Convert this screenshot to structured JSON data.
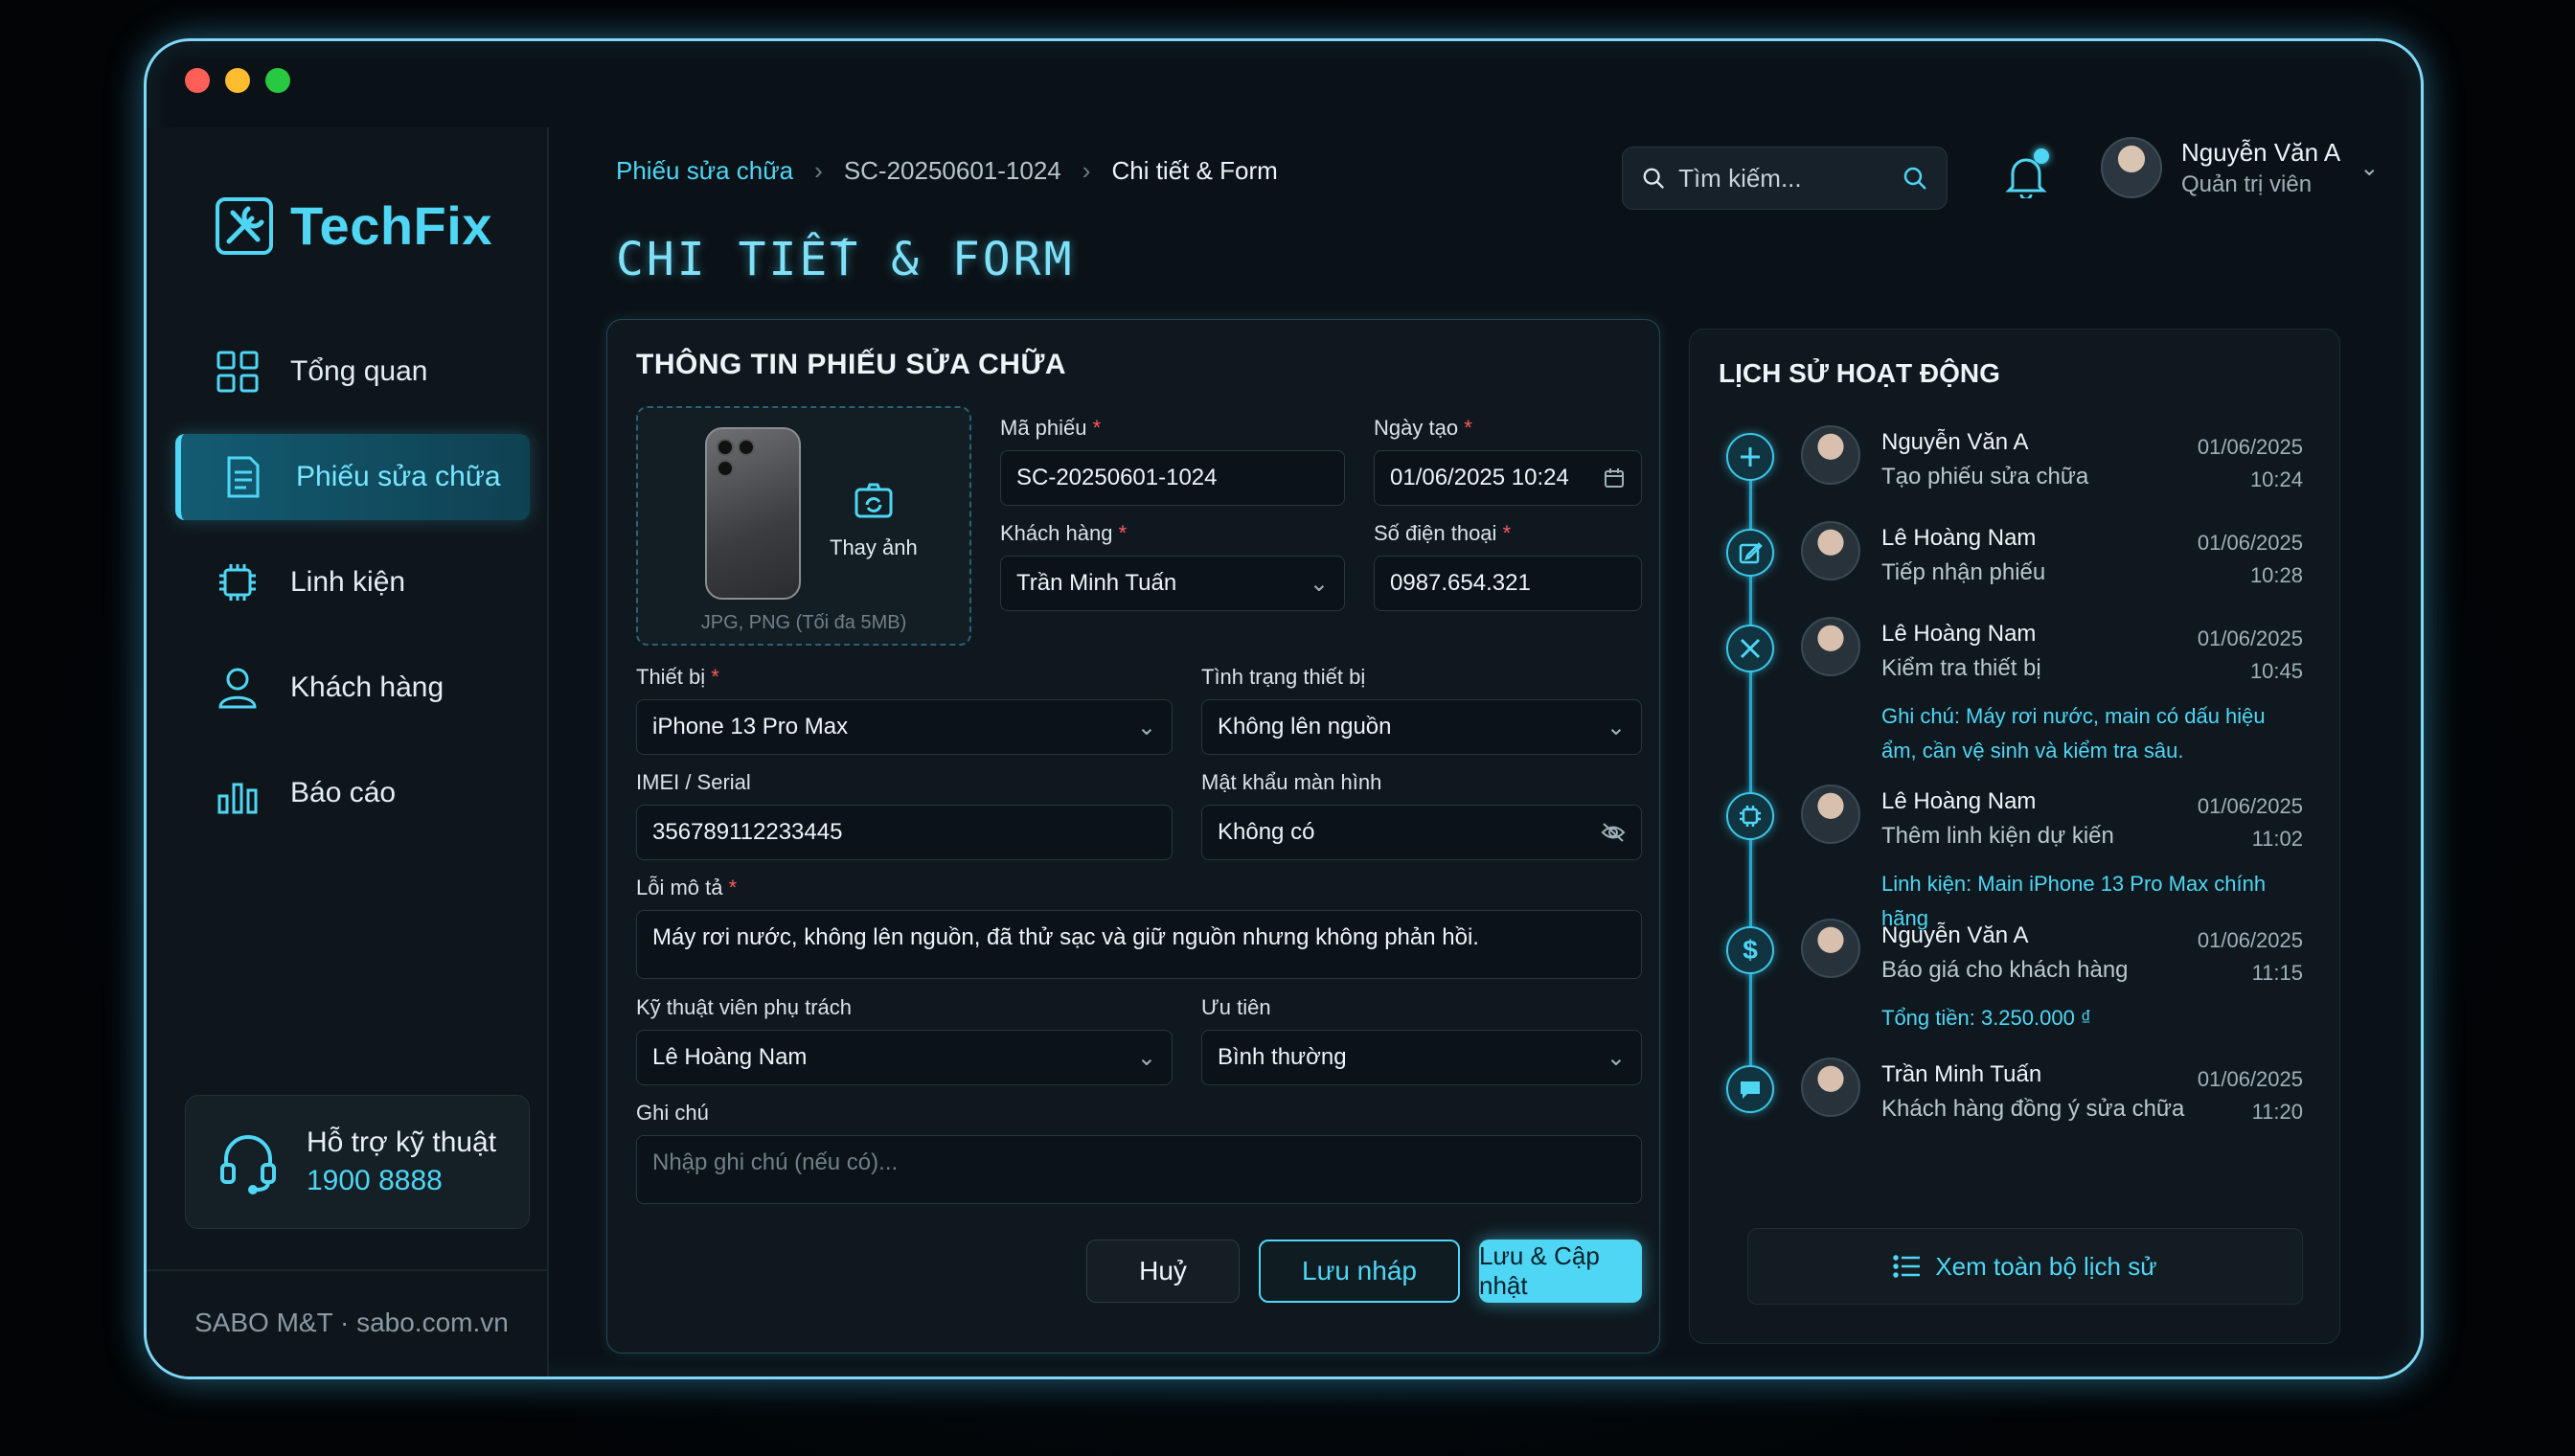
{
  "app": {
    "logo_text": "TechFix",
    "colors": {
      "accent": "#4fd6f5",
      "background": "#0b1217",
      "required": "#ff5a5a"
    }
  },
  "sidebar": {
    "items": [
      {
        "label": "Tổng quan",
        "icon": "dashboard-icon"
      },
      {
        "label": "Phiếu sửa chữa",
        "icon": "document-icon",
        "active": true
      },
      {
        "label": "Linh kiện",
        "icon": "chip-icon"
      },
      {
        "label": "Khách hàng",
        "icon": "user-icon"
      },
      {
        "label": "Báo cáo",
        "icon": "bar-chart-icon"
      }
    ],
    "support": {
      "title": "Hỗ trợ kỹ thuật",
      "phone": "1900 8888"
    },
    "footer": "SABO M&T · sabo.com.vn"
  },
  "header": {
    "breadcrumb": [
      "Phiếu sửa chữa",
      "SC-20250601-1024",
      "Chi tiết & Form"
    ],
    "search_placeholder": "Tìm kiếm...",
    "user": {
      "name": "Nguyễn Văn A",
      "role": "Quản trị viên"
    }
  },
  "page_title": "CHI TIẾT & FORM",
  "form": {
    "title": "THÔNG TIN PHIẾU SỬA CHỮA",
    "photo": {
      "change_label": "Thay ảnh",
      "hint": "JPG, PNG (Tối đa 5MB)"
    },
    "ticket_id": {
      "label": "Mã phiếu",
      "value": "SC-20250601-1024"
    },
    "created_date": {
      "label": "Ngày tạo",
      "value": "01/06/2025 10:24"
    },
    "customer": {
      "label": "Khách hàng",
      "value": "Trần Minh Tuấn"
    },
    "phone": {
      "label": "Số điện thoại",
      "value": "0987.654.321"
    },
    "device": {
      "label": "Thiết bị",
      "value": "iPhone 13 Pro Max"
    },
    "device_status": {
      "label": "Tình trạng thiết bị",
      "value": "Không lên nguồn"
    },
    "imei": {
      "label": "IMEI / Serial",
      "value": "356789112233445"
    },
    "screen_password": {
      "label": "Mật khẩu màn hình",
      "value": "Không có"
    },
    "issue": {
      "label": "Lỗi mô tả",
      "value": "Máy rơi nước, không lên nguồn, đã thử sạc và giữ nguồn nhưng không phản hồi."
    },
    "technician": {
      "label": "Kỹ thuật viên phụ trách",
      "value": "Lê Hoàng Nam"
    },
    "priority": {
      "label": "Ưu tiên",
      "value": "Bình thường"
    },
    "note": {
      "label": "Ghi chú",
      "placeholder": "Nhập ghi chú (nếu có)..."
    },
    "buttons": {
      "cancel": "Huỷ",
      "draft": "Lưu nháp",
      "save": "Lưu & Cập nhật"
    }
  },
  "activity": {
    "title": "LỊCH SỬ HOẠT ĐỘNG",
    "items": [
      {
        "icon": "plus-icon",
        "name": "Nguyễn Văn A",
        "desc": "Tạo phiếu sửa chữa",
        "date": "01/06/2025",
        "time": "10:24",
        "note": ""
      },
      {
        "icon": "edit-icon",
        "name": "Lê Hoàng Nam",
        "desc": "Tiếp nhận phiếu",
        "date": "01/06/2025",
        "time": "10:28",
        "note": ""
      },
      {
        "icon": "tools-icon",
        "name": "Lê Hoàng Nam",
        "desc": "Kiểm tra thiết bị",
        "date": "01/06/2025",
        "time": "10:45",
        "note": "Ghi chú: Máy rơi nước, main có dấu hiệu ẩm, cần vệ sinh và kiểm tra sâu."
      },
      {
        "icon": "chip-icon",
        "name": "Lê Hoàng Nam",
        "desc": "Thêm linh kiện dự kiến",
        "date": "01/06/2025",
        "time": "11:02",
        "note": "Linh kiện: Main iPhone 13 Pro Max chính hãng"
      },
      {
        "icon": "dollar-icon",
        "name": "Nguyễn Văn A",
        "desc": "Báo giá cho khách hàng",
        "date": "01/06/2025",
        "time": "11:15",
        "note": "Tổng tiền: 3.250.000 ₫"
      },
      {
        "icon": "chat-icon",
        "name": "Trần Minh Tuấn",
        "desc": "Khách hàng đồng ý sửa chữa",
        "date": "01/06/2025",
        "time": "11:20",
        "note": ""
      }
    ],
    "view_all": "Xem toàn bộ lịch sử"
  }
}
